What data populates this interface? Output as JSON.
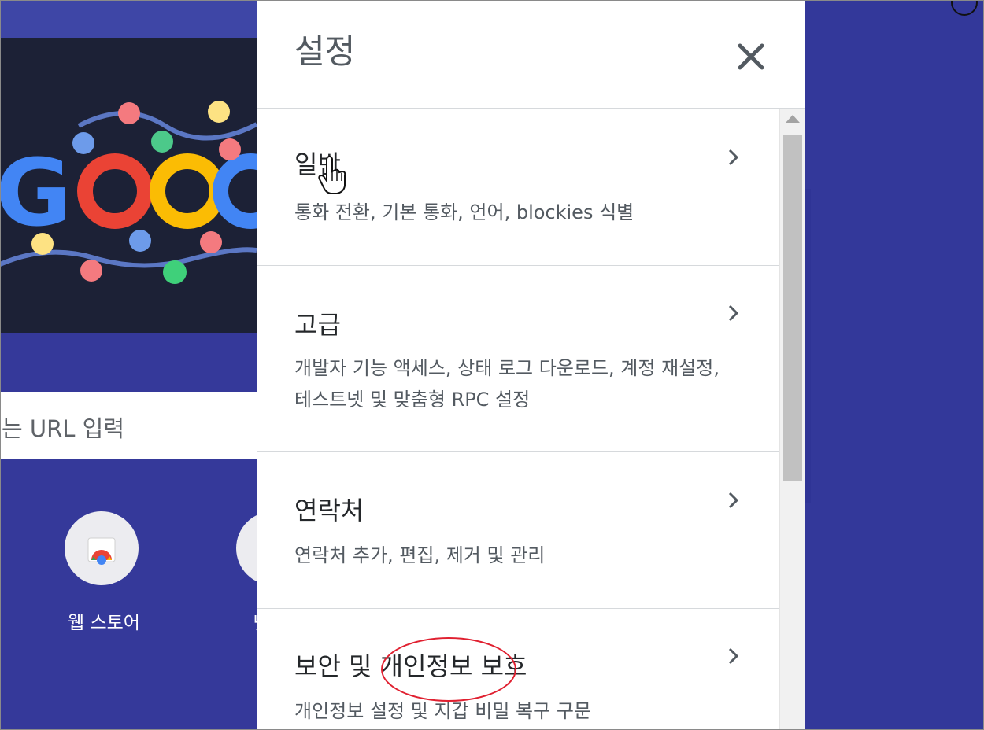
{
  "background": {
    "search_placeholder": "는 URL 입력",
    "shortcuts": [
      {
        "label": "웹 스토어",
        "icon": "chrome-web-store-icon"
      },
      {
        "label": "넷",
        "icon": "shortcut-icon"
      }
    ],
    "doodle_text": "Goog"
  },
  "settings": {
    "title": "설정",
    "close_icon": "close-icon",
    "items": [
      {
        "title": "일반",
        "description": "통화 전환, 기본 통화, 언어, blockies 식별"
      },
      {
        "title": "고급",
        "description": "개발자 기능 액세스, 상태 로그 다운로드, 계정 재설정, 테스트넷 및 맞춤형 RPC 설정"
      },
      {
        "title": "연락처",
        "description": "연락처 추가, 편집, 제거 및 관리"
      },
      {
        "title": "보안 및 개인정보 보호",
        "description": "개인정보 설정 및 지갑 비밀 복구 구문"
      }
    ]
  },
  "colors": {
    "background_blue": "#35399a",
    "panel_bg": "#ffffff",
    "title_text": "#24272a",
    "secondary_text": "#535a61",
    "annotation_red": "#e02030"
  }
}
